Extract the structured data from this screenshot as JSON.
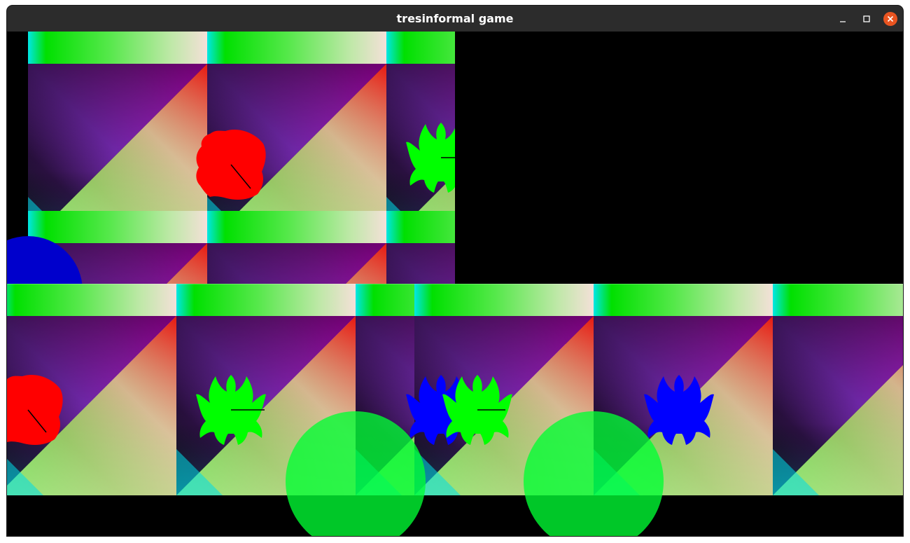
{
  "window": {
    "title": "tresinformal game",
    "controls": {
      "minimize": "minimize-icon",
      "maximize": "maximize-icon",
      "close": "close-icon"
    },
    "close_color": "#e95420"
  },
  "game": {
    "background": "#000000",
    "tile_palette": {
      "top_band": [
        "#00e5e5",
        "#00e000",
        "#ffd8e0"
      ],
      "dark_corner": "#0a1010",
      "violet": "#8a2be2",
      "magenta": "#ff00ff",
      "red": "#ff0000",
      "green": "#00dd00",
      "cream": "#f0f0c8"
    },
    "players": [
      {
        "name": "red-player",
        "color": "#ff0000",
        "icon": "phoenix-icon"
      },
      {
        "name": "green-player",
        "color": "#00ff00",
        "icon": "dragon-icon"
      },
      {
        "name": "blue-player",
        "color": "#0000ff",
        "icon": "dragon-icon"
      }
    ],
    "items": [
      {
        "name": "blue-circle",
        "color": "#0000cc"
      },
      {
        "name": "green-circle",
        "color": "#00ff33"
      }
    ]
  }
}
